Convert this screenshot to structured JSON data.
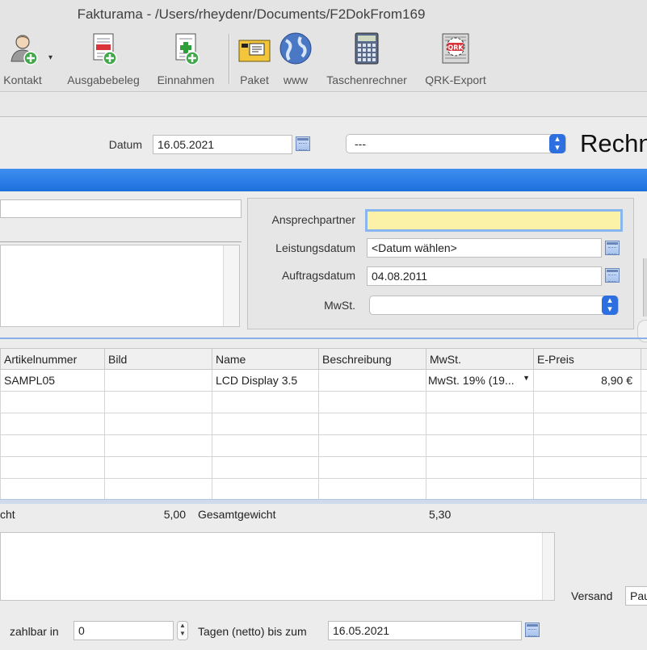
{
  "window": {
    "title": "Fakturama - /Users/rheydenr/Documents/F2DokFrom169"
  },
  "toolbar": {
    "items": [
      {
        "label": "Kontakt",
        "icon": "contact-add-icon"
      },
      {
        "label": "Ausgabebeleg",
        "icon": "expense-add-icon"
      },
      {
        "label": "Einnahmen",
        "icon": "income-add-icon"
      },
      {
        "label": "Paket",
        "icon": "package-icon"
      },
      {
        "label": "www",
        "icon": "globe-icon"
      },
      {
        "label": "Taschenrechner",
        "icon": "calculator-icon"
      },
      {
        "label": "QRK-Export",
        "icon": "qrk-export-icon"
      }
    ],
    "dropdown_marker": "▾"
  },
  "header": {
    "date_label": "Datum",
    "date_value": "16.05.2021",
    "type_select": "---",
    "doc_title": "Rechn"
  },
  "details": {
    "contact_person_label": "Ansprechpartner",
    "contact_person_value": "",
    "service_date_label": "Leistungsdatum",
    "service_date_value": "<Datum wählen>",
    "order_date_label": "Auftragsdatum",
    "order_date_value": "04.08.2011",
    "vat_label": "MwSt.",
    "vat_value": ""
  },
  "table": {
    "columns": [
      "Artikelnummer",
      "Bild",
      "Name",
      "Beschreibung",
      "MwSt.",
      "E-Preis"
    ],
    "rows": [
      {
        "artikelnummer": "SAMPL05",
        "bild": "",
        "name": "LCD Display 3.5",
        "beschreibung": "",
        "mwst": "MwSt. 19% (19...",
        "epreis": "8,90 €"
      }
    ]
  },
  "totals": {
    "weight_label_partial": "cht",
    "weight_value": "5,00",
    "total_weight_label": "Gesamtgewicht",
    "total_weight_value": "5,30"
  },
  "shipping": {
    "label": "Versand",
    "value": "Pau"
  },
  "payment": {
    "pay_in_label": "zahlbar in",
    "days_value": "0",
    "days_suffix_label": "Tagen (netto) bis zum",
    "due_date_value": "16.05.2021"
  },
  "colors": {
    "accent_blue": "#2d6fe0",
    "highlight_yellow": "#fbf2a8",
    "band_blue": "#1d6fdc"
  }
}
